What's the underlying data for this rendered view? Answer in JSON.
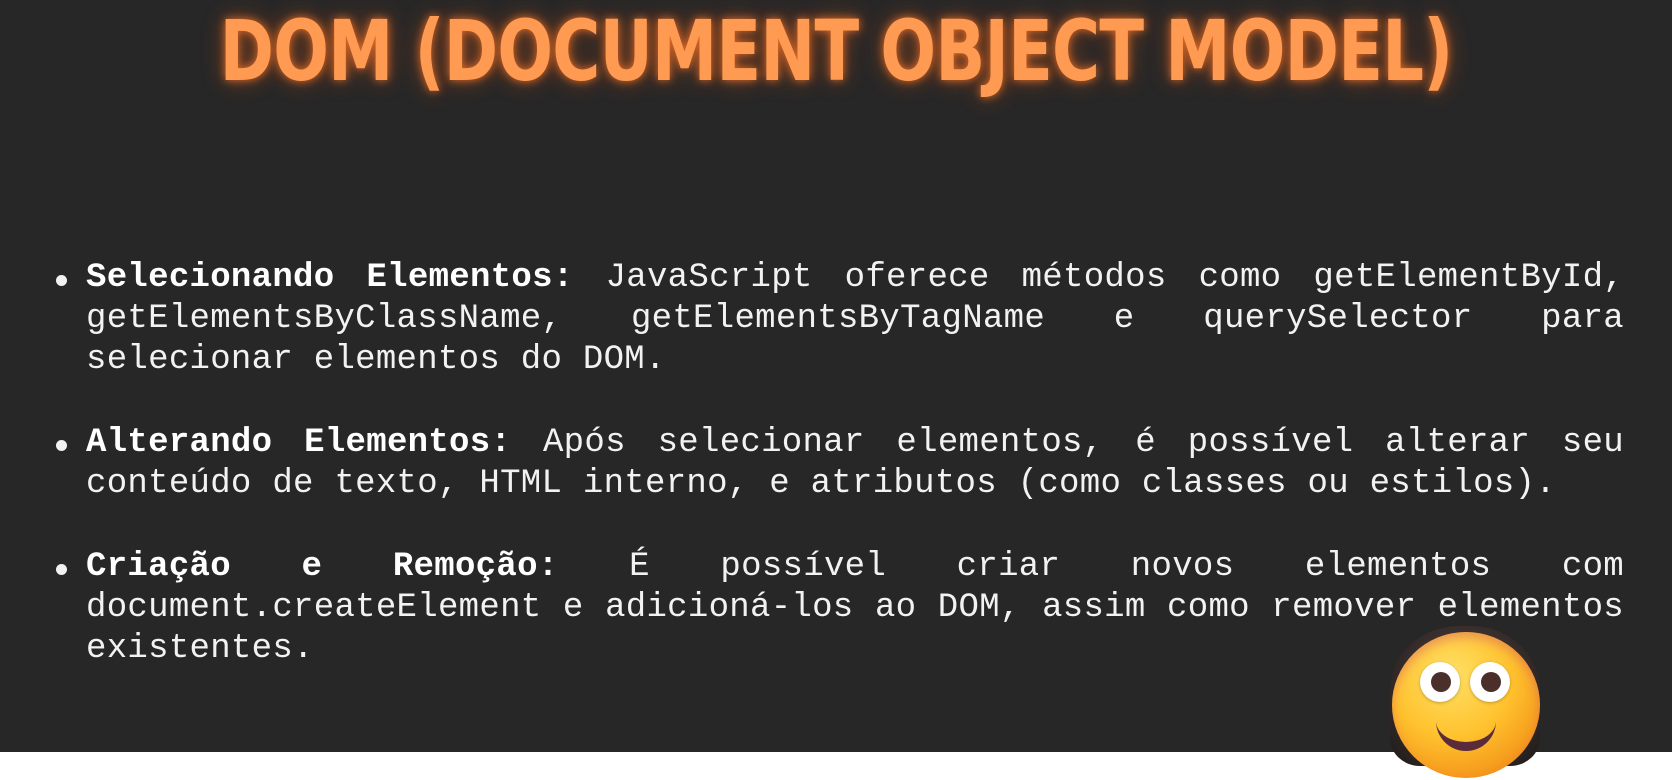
{
  "slide": {
    "title": "DOM (DOCUMENT OBJECT MODEL)",
    "bullets": [
      {
        "term": "Selecionando Elementos:",
        "text": "JavaScript oferece métodos como getElementById, getElementsByClassName, getElementsByTagName e querySelector para selecionar elementos do DOM."
      },
      {
        "term": "Alterando Elementos:",
        "text": "Após selecionar elementos, é possível alterar seu conteúdo de texto, HTML interno, e atributos (como classes ou estilos)."
      },
      {
        "term": "Criação e Remoção:",
        "text": "É possível criar novos elementos com document.createElement e adicioná-los ao DOM, assim como remover elementos existentes."
      }
    ]
  },
  "overlay": {
    "icon": "smiling-face-emoji-icon"
  },
  "colors": {
    "background": "#272727",
    "title": "#ff9a52",
    "text": "#f2f2f2"
  }
}
